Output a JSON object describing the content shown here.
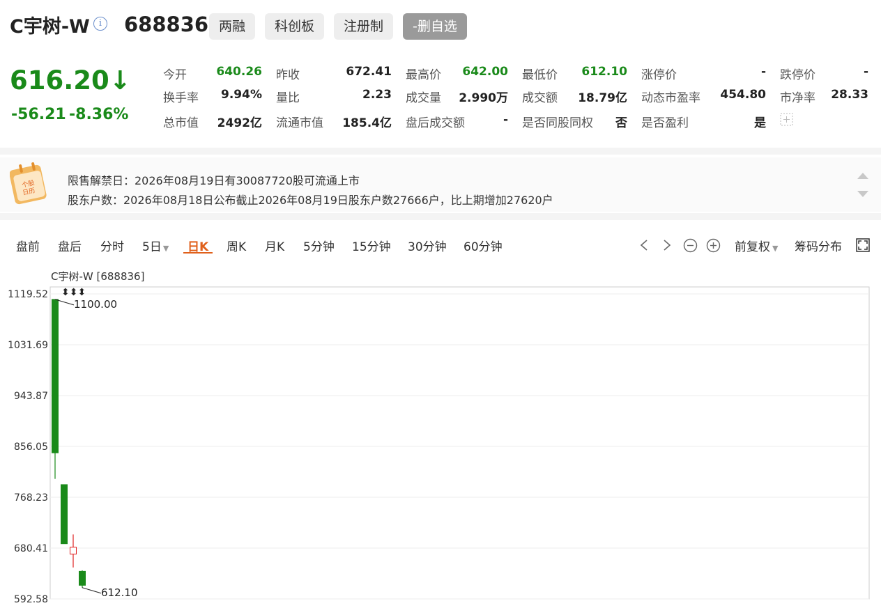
{
  "header": {
    "stock_name": "C宇树-W",
    "info_icon": "i",
    "stock_code": "688836",
    "tags": [
      "两融",
      "科创板",
      "注册制"
    ],
    "remove_watchlist": "-删自选"
  },
  "quote": {
    "price": "616.20↓",
    "change": "-56.21",
    "change_pct": "-8.36%",
    "rows": [
      [
        {
          "label": "今开",
          "value": "640.26",
          "green": true
        },
        {
          "label": "昨收",
          "value": "672.41",
          "green": false
        },
        {
          "label": "最高价",
          "value": "642.00",
          "green": true
        },
        {
          "label": "最低价",
          "value": "612.10",
          "green": true
        },
        {
          "label": "涨停价",
          "value": "-",
          "green": false
        },
        {
          "label": "跌停价",
          "value": "-",
          "green": false
        }
      ],
      [
        {
          "label": "换手率",
          "value": "9.94%",
          "green": false
        },
        {
          "label": "量比",
          "value": "2.23",
          "green": false
        },
        {
          "label": "成交量",
          "value": "2.990万",
          "green": false
        },
        {
          "label": "成交额",
          "value": "18.79亿",
          "green": false
        },
        {
          "label": "动态市盈率",
          "value": "454.80",
          "green": false
        },
        {
          "label": "市净率",
          "value": "28.33",
          "green": false
        }
      ],
      [
        {
          "label": "总市值",
          "value": "2492亿",
          "green": false
        },
        {
          "label": "流通市值",
          "value": "185.4亿",
          "green": false
        },
        {
          "label": "盘后成交额",
          "value": "-",
          "green": false
        },
        {
          "label": "是否同股同权",
          "value": "否",
          "green": false
        },
        {
          "label": "是否盈利",
          "value": "是",
          "green": false
        }
      ]
    ]
  },
  "notice": {
    "calendar_icon_text": [
      "个股",
      "日历"
    ],
    "lines": [
      "限售解禁日：2026年08月19日有30087720股可流通上市",
      "股东户数：2026年08月18日公布截止2026年08月19日股东户数27666户，比上期增加27620户"
    ]
  },
  "toolbar": {
    "tabs": [
      "盘前",
      "盘后",
      "分时",
      "5日",
      "日K",
      "周K",
      "月K",
      "5分钟",
      "15分钟",
      "30分钟",
      "60分钟"
    ],
    "active_tab": "日K",
    "adjust": "前复权",
    "chip": "筹码分布"
  },
  "colors": {
    "up": "#e02020",
    "down": "#1a8a1a",
    "accent": "#e0601b"
  },
  "chart_data": {
    "type": "candlestick",
    "title": "C宇树-W [688836]",
    "ylim": [
      592.58,
      1119.52
    ],
    "y_ticks": [
      "1119.52",
      "1031.69",
      "943.87",
      "856.05",
      "768.23",
      "680.41",
      "592.58"
    ],
    "grid": true,
    "candles": [
      {
        "open": 1110.0,
        "close": 845.0,
        "high": 1110.0,
        "low": 800.0
      },
      {
        "open": 790.0,
        "close": 688.0,
        "high": 790.0,
        "low": 688.0
      },
      {
        "open": 670.0,
        "close": 682.0,
        "high": 704.0,
        "low": 647.0
      },
      {
        "open": 640.26,
        "close": 616.2,
        "high": 642.0,
        "low": 612.1
      }
    ],
    "annotations": [
      {
        "label": "1100.00",
        "candle": 0,
        "value": 1110.0
      },
      {
        "label": "612.10",
        "candle": 3,
        "value": 612.1
      }
    ],
    "markers": "⬍⬍⬍"
  }
}
